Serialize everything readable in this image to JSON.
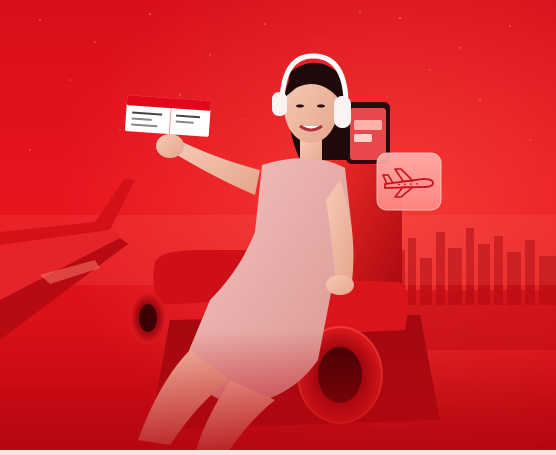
{
  "banner": {
    "kind": "promotional-hero",
    "accent_color": "#e1081b",
    "deep_color": "#9c0410",
    "highlight_color": "#ff6a5f",
    "icons": {
      "app_card": "airplane-icon",
      "ticket": "boarding-pass-icon",
      "phone": "smartphone-icon",
      "headphones": "headphones-icon"
    },
    "ticket": {
      "header_text": "",
      "body_text": ""
    }
  }
}
